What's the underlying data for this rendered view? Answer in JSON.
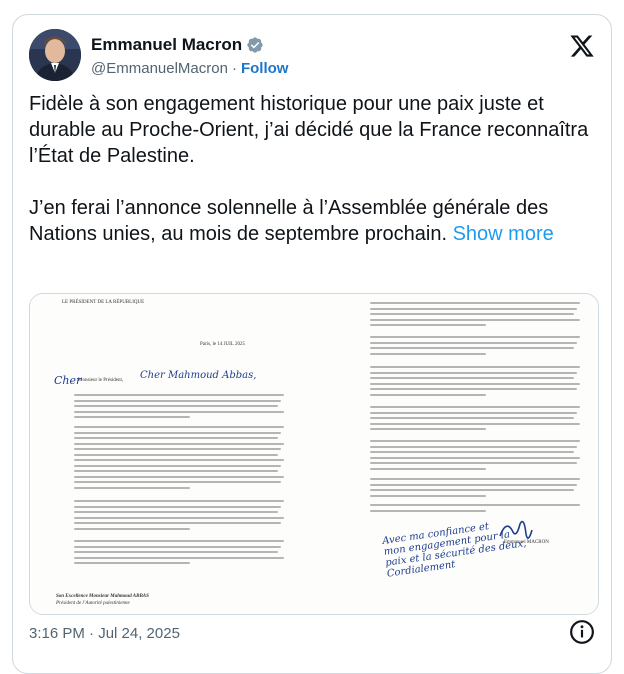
{
  "author": {
    "display_name": "Emmanuel Macron",
    "handle": "@EmmanuelMacron",
    "separator": "·",
    "follow_label": "Follow"
  },
  "tweet": {
    "paragraph1": "Fidèle à son engagement historique pour une paix juste et durable au Proche-Orient, j’ai décidé que la France reconnaîtra l’État de Palestine.",
    "paragraph2": "J’en ferai l’annonce solennelle à l’Assemblée générale des Nations unies, au mois de septembre prochain.",
    "show_more_label": "Show more"
  },
  "letter": {
    "header": "LE PRÉSIDENT DE LA RÉPUBLIQUE",
    "place_date": "Paris, le 14 JUIL 2025",
    "salutation": "Monsieur le Président,",
    "handwritten_greeting": "Cher Mahmoud Abbas,",
    "addressee_line1": "Son Excellence Monsieur Mahmoud ABBAS",
    "addressee_line2": "Président de l’Autorité palestinienne",
    "signature_name": "Emmanuel MACRON"
  },
  "timestamp": "3:16 PM · Jul 24, 2025",
  "colors": {
    "link": "#1d9bf0",
    "follow": "#1d76c9",
    "verified": "#829aab",
    "ink": "#1f3d8f"
  },
  "icons": {
    "verified": "verified-badge-icon",
    "x": "x-logo-icon",
    "info": "info-icon"
  }
}
